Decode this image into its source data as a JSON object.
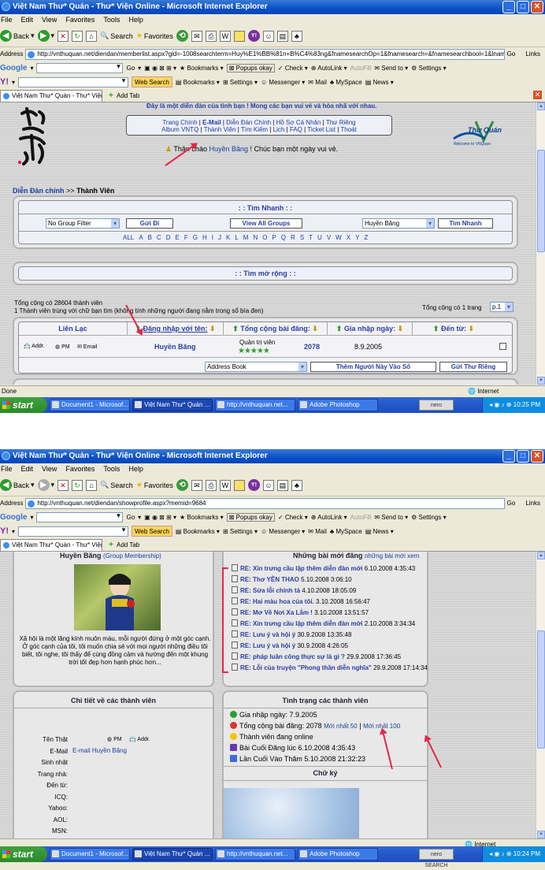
{
  "w1": {
    "title": "Việt Nam Thư* Quán - Thư* Viện Online - Microsoft Internet Explorer",
    "address_label": "Address",
    "url": "http://vnthuquan.net/diendan/memberlist.aspx?gid=-1008searchterm=Huy%E1%BB%81n+B%C4%83ng&fnamesearchOp=1&fnamesearch=&fnamesearchbool=1&lname",
    "tab_label": "Việt Nam Thư* Quán - Thư* Viện...",
    "banner_text": "Đây là một diễn đàn của tình bạn ! Mong các bạn vui vẻ và hòa nhã với nhau.",
    "nav_row1": [
      "Trang Chính",
      "E-Mail",
      "Diễn Đàn Chính",
      "Hồ Sơ Cá Nhân",
      "Thư Riêng"
    ],
    "nav_row2": [
      "Album VNTQ",
      "Thành Viên",
      "Tìm Kiếm",
      "Lịch",
      "FAQ",
      "Ticket List",
      "Thoát"
    ],
    "greeting_prefix": "Thân chào",
    "greeting_name": "Huyền Băng",
    "greeting_suffix": "! Chúc bạn một ngày vui vẻ.",
    "logo_text": "Thư Quán",
    "logo_sub": "Welcome to VNQuan",
    "breadcrumb_root": "Diễn Đàn chính",
    "breadcrumb_sep": ">>",
    "breadcrumb_current": "Thành Viên",
    "quick_search_title": ": : Tìm Nhanh : :",
    "group_filter": "No Group Filter",
    "go_button": "Gửi Đi",
    "view_all_groups": "View All Groups",
    "search_value": "Huyền Băng",
    "quick_search_button": "Tìm Nhanh",
    "alphabet": [
      "ALL",
      "A",
      "B",
      "C",
      "D",
      "E",
      "F",
      "G",
      "H",
      "I",
      "J",
      "K",
      "L",
      "M",
      "N",
      "O",
      "P",
      "Q",
      "R",
      "S",
      "T",
      "U",
      "V",
      "W",
      "X",
      "Y",
      "Z"
    ],
    "advanced_search_title": ": : Tìm mở rộng : :",
    "total_members": "Tổng cộng có 28604 thành viên",
    "match_text": "1 Thành viên trùng với chữ bạn tìm (không tính những người đang nằm trong sổ bìa đen)",
    "pages_label": "Tổng cộng có 1 trang",
    "page_select": "p.1",
    "columns": [
      "Liên Lạc",
      "Đăng nhập với tên:",
      "Tổng cộng bài đăng:",
      "Gia nhập ngày:",
      "Đến từ:"
    ],
    "row": {
      "addr": "Addr.",
      "pm": "PM",
      "email": "Email",
      "name": "Huyền Băng",
      "rank": "Quản trị viên",
      "stars": "★★★★★",
      "posts": "2078",
      "joined": "8.9.2005",
      "from": ""
    },
    "address_book": "Address Book",
    "add_button": "Thêm Người Này Vào Sổ",
    "send_pm_button": "Gửi Thư Riêng",
    "status": "Done",
    "zone": "Internet",
    "clock": "10:25 PM"
  },
  "w2": {
    "title": "Việt Nam Thư* Quán - Thư* Viện Online - Microsoft Internet Explorer",
    "address_label": "Address",
    "url": "http://vnthuquan.net/diendan/showprofile.aspx?memid=9684",
    "tab_label": "Việt Nam Thư* Quán - Thư* Viện...",
    "profile_name": "Huyền Băng",
    "profile_group": "(Group Membership)",
    "bio": "Xã hội là một lăng kính muôn màu, mỗi người đứng ở một góc cạnh. Ở góc cạnh của tôi, tôi muốn chia sẻ với mọi người những điều tôi biết, tôi nghe, tôi thấy để cùng đồng cảm và hướng đến một khung trời tốt đẹp hơn hạnh phúc hơn...",
    "recent_title": "Những bài mới đăng",
    "recent_more": "những bài mới xem",
    "posts": [
      {
        "title": "RE: Xin trưng cầu lập thêm diễn đàn mới",
        "date": "6.10.2008 4:35:43"
      },
      {
        "title": "RE: Thơ YÊN THAO",
        "date": "5.10.2008 3:06:10"
      },
      {
        "title": "RE: Sửa lỗi chính tả",
        "date": "4.10.2008 18:05:09"
      },
      {
        "title": "RE: Hai màu hoa của tôi.",
        "date": "3.10.2008 16:56:47"
      },
      {
        "title": "RE: Mơ Về Nơi Xa Lắm !",
        "date": "3.10.2008 13:51:57"
      },
      {
        "title": "RE: Xin trưng cầu lập thêm diễn đàn mới",
        "date": "2.10.2008 3:34:34"
      },
      {
        "title": "RE: Lưu ý và hội ý",
        "date": "30.9.2008 13:35:48"
      },
      {
        "title": "RE: Lưu ý và hội ý",
        "date": "30.9.2008 4:26:05"
      },
      {
        "title": "RE: pháp luân công thực sự là gì ?",
        "date": "29.9.2008 17:36:45"
      },
      {
        "title": "RE: Lỗi của truyện \"Phong thần diễn nghĩa\"",
        "date": "29.9.2008 17:14:34"
      }
    ],
    "details_title": "Chi tiết về các thành viên",
    "detail_labels": [
      "Tên Thật",
      "E-Mail",
      "Sinh nhật",
      "Trang nhà:",
      "Đến từ:",
      "ICQ:",
      "Yahoo:",
      "AOL:",
      "MSN:"
    ],
    "detail_pm": "PM",
    "detail_addr": "Addr.",
    "detail_email": "E-mail Huyền Băng",
    "status_title": "Tình trạng các thành viên",
    "joined": "Gia nhập ngày: 7.9.2005",
    "total_posts": "Tổng cộng bài đăng: 2078",
    "latest50": "Mới nhất 50",
    "latest_sep": "|",
    "latest100": "Mới nhất 100",
    "online": "Thành viên đang online",
    "last_post": "Bài Cuối Đăng lúc 6.10.2008 4:35:43",
    "last_visit": "Lần Cuối Vào Thăm 5.10.2008 21:32:23",
    "signature_title": "Chữ ký",
    "status": "",
    "zone": "Internet",
    "clock": "10:24 PM"
  },
  "menu": [
    "File",
    "Edit",
    "View",
    "Favorites",
    "Tools",
    "Help"
  ],
  "toolbar": {
    "back": "Back",
    "search": "Search",
    "favorites": "Favorites",
    "go": "Go",
    "links": "Links"
  },
  "google_bar": {
    "label": "Google",
    "go": "Go",
    "bookmarks": "Bookmarks",
    "popups": "Popups okay",
    "check": "Check",
    "autolink": "AutoLink",
    "autofill": "AutoFill",
    "sendto": "Send to",
    "settings": "Settings"
  },
  "yahoo_bar": {
    "label": "Y!",
    "web_search": "Web Search",
    "bookmarks": "Bookmarks",
    "settings": "Settings",
    "messenger": "Messenger",
    "mail": "Mail",
    "myspace": "MySpace",
    "news": "News"
  },
  "add_tab": "Add Tab",
  "taskbar": {
    "start": "start",
    "items": [
      "Document1 - Microsof...",
      "Việt Nam Thư* Quán ...",
      "http://vnthuquan.net...",
      "Adobe Photoshop"
    ],
    "nero": "nero SEARCH"
  }
}
